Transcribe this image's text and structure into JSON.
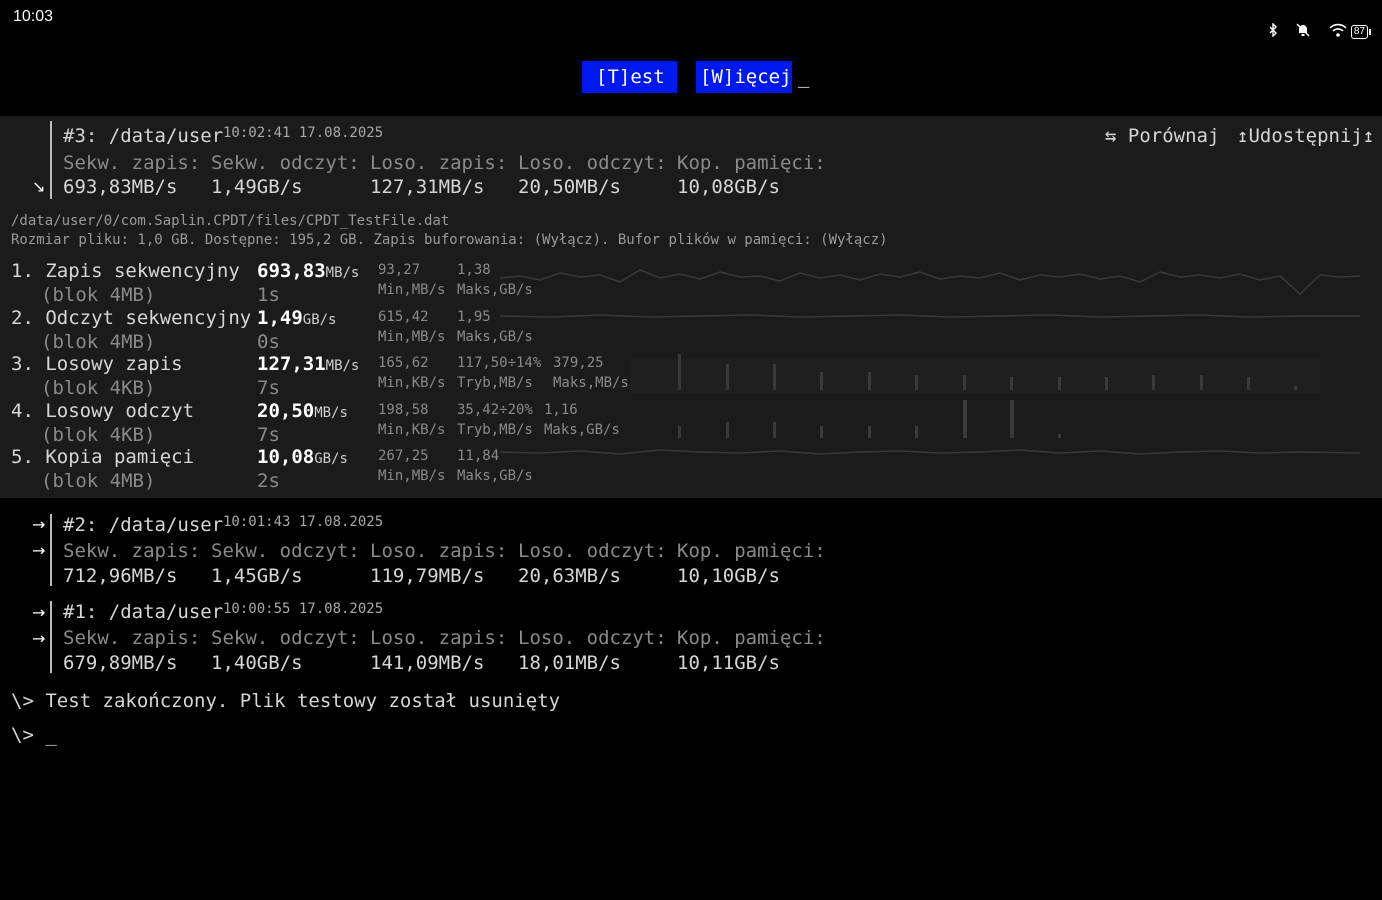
{
  "status_bar": {
    "time": "10:03",
    "battery": "87",
    "icons": [
      "bluetooth-icon",
      "bell-off-icon",
      "wifi-icon",
      "battery-icon"
    ]
  },
  "toolbar": {
    "test_label": "[T]est",
    "more_label": "[W]ięcej",
    "cursor": "_"
  },
  "active_run": {
    "title": "#3: /data/user",
    "timestamp": "10:02:41 17.08.2025",
    "compare_label": "⇆ Porównaj",
    "share_label": "↥Udostępnij↥",
    "collapse_icon": "↘",
    "headers": [
      "Sekw. zapis:",
      "Sekw. odczyt:",
      "Loso. zapis:",
      "Loso. odczyt:",
      "Kop. pamięci:"
    ],
    "values": [
      "693,83MB/s",
      "1,49GB/s",
      "127,31MB/s",
      "20,50MB/s",
      "10,08GB/s"
    ],
    "file_path": "/data/user/0/com.Saplin.CPDT/files/CPDT_TestFile.dat",
    "file_info": "Rozmiar pliku: 1,0 GB. Dostępne: 195,2 GB. Zapis buforowania: (Wyłącz). Bufor plików w pamięci: (Wyłącz)",
    "tests": [
      {
        "name": "1. Zapis sekwencyjny",
        "block": "(blok 4MB)",
        "value": "693,83",
        "unit": "MB/s",
        "time": "1s",
        "stats": [
          {
            "v": "93,27",
            "l": "Min,MB/s"
          },
          {
            "v": "1,38",
            "l": "Maks,GB/s"
          }
        ]
      },
      {
        "name": "2. Odczyt sekwencyjny",
        "block": "(blok 4MB)",
        "value": "1,49",
        "unit": "GB/s",
        "time": "0s",
        "stats": [
          {
            "v": "615,42",
            "l": "Min,MB/s"
          },
          {
            "v": "1,95",
            "l": "Maks,GB/s"
          }
        ]
      },
      {
        "name": "3. Losowy zapis",
        "block": "(blok 4KB)",
        "value": "127,31",
        "unit": "MB/s",
        "time": "7s",
        "stats": [
          {
            "v": "165,62",
            "l": "Min,KB/s"
          },
          {
            "v": "117,50÷14%",
            "l": "Tryb,MB/s"
          },
          {
            "v": "379,25",
            "l": "Maks,MB/s"
          }
        ]
      },
      {
        "name": "4. Losowy odczyt",
        "block": "(blok 4KB)",
        "value": "20,50",
        "unit": "MB/s",
        "time": "7s",
        "stats": [
          {
            "v": "198,58",
            "l": "Min,KB/s"
          },
          {
            "v": "35,42÷20%",
            "l": "Tryb,MB/s"
          },
          {
            "v": "1,16",
            "l": "Maks,GB/s"
          }
        ]
      },
      {
        "name": "5. Kopia pamięci",
        "block": "(blok 4MB)",
        "value": "10,08",
        "unit": "GB/s",
        "time": "2s",
        "stats": [
          {
            "v": "267,25",
            "l": "Min,MB/s"
          },
          {
            "v": "11,84",
            "l": "Maks,GB/s"
          }
        ]
      }
    ]
  },
  "history": [
    {
      "title": "#2: /data/user",
      "timestamp": "10:01:43 17.08.2025",
      "values": [
        "712,96MB/s",
        "1,45GB/s",
        "119,79MB/s",
        "20,63MB/s",
        "10,10GB/s"
      ]
    },
    {
      "title": "#1: /data/user",
      "timestamp": "10:00:55 17.08.2025",
      "values": [
        "679,89MB/s",
        "1,40GB/s",
        "141,09MB/s",
        "18,01MB/s",
        "10,11GB/s"
      ]
    }
  ],
  "console": {
    "message": "\\> Test zakończony. Plik testowy został usunięty",
    "prompt": "\\> _"
  }
}
